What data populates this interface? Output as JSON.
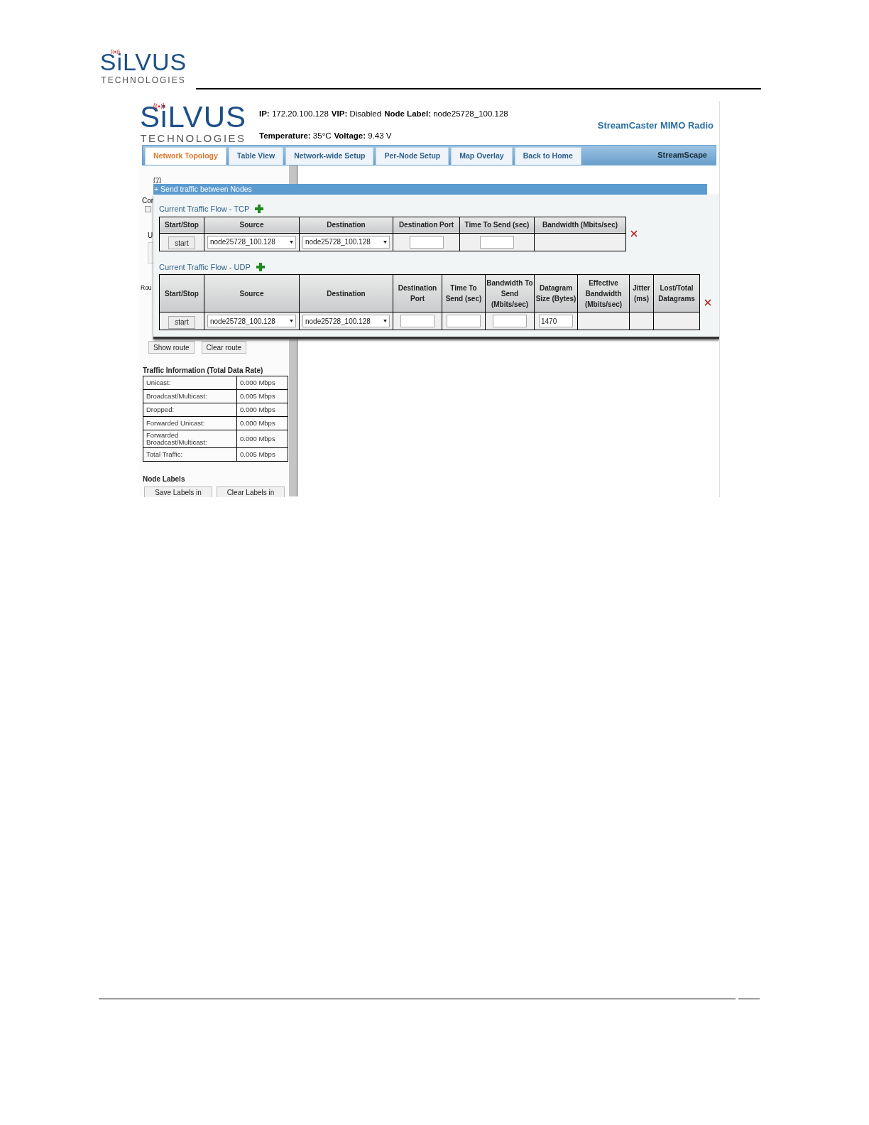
{
  "document_logo": {
    "wordmark": "SiLVUS",
    "tagline": "TECHNOLOGIES"
  },
  "app": {
    "logo": {
      "wordmark": "SiLVUS",
      "tagline": "TECHNOLOGIES"
    },
    "status_lines": [
      [
        {
          "label": "IP:",
          "value": "172.20.100.128"
        },
        {
          "label": "VIP:",
          "value": "Disabled"
        },
        {
          "label": "Node Label:",
          "value": "node25728_100.128"
        }
      ],
      [
        {
          "label": "Temperature:",
          "value": "35°C"
        },
        {
          "label": "Voltage:",
          "value": "9.43 V"
        }
      ]
    ],
    "product": "StreamCaster MIMO Radio",
    "tabs": [
      {
        "label": "Network Topology",
        "selected": true
      },
      {
        "label": "Table View",
        "selected": false
      },
      {
        "label": "Network-wide Setup",
        "selected": false
      },
      {
        "label": "Per-Node Setup",
        "selected": false
      },
      {
        "label": "Map Overlay",
        "selected": false
      },
      {
        "label": "Back to Home",
        "selected": false
      }
    ],
    "brand": "StreamScape",
    "help_link": "(?)",
    "section_bar": "+ Send traffic between Nodes",
    "covered_fragments": [
      "Cor",
      "U",
      "Rou"
    ],
    "covered_checkbox": {
      "checked": false
    },
    "flows": [
      {
        "title": "Current Traffic Flow - TCP",
        "columns": [
          "Start/Stop",
          "Source",
          "Destination",
          "Destination Port",
          "Time To Send (sec)",
          "Bandwidth (Mbits/sec)"
        ],
        "rows": [
          {
            "cells": [
              {
                "kind": "button",
                "text": "start"
              },
              {
                "kind": "select",
                "value": "node25728_100.128"
              },
              {
                "kind": "select",
                "value": "node25728_100.128"
              },
              {
                "kind": "input"
              },
              {
                "kind": "input"
              },
              {
                "kind": "empty"
              }
            ]
          }
        ]
      },
      {
        "title": "Current Traffic Flow - UDP",
        "columns": [
          "Start/Stop",
          "Source",
          "Destination",
          "Destination Port",
          "Time To Send (sec)",
          "Bandwidth To Send (Mbits/sec)",
          "Datagram Size (Bytes)",
          "Effective Bandwidth (Mbits/sec)",
          "Jitter (ms)",
          "Lost/Total Datagrams"
        ],
        "rows": [
          {
            "cells": [
              {
                "kind": "button",
                "text": "start"
              },
              {
                "kind": "select",
                "value": "node25728_100.128"
              },
              {
                "kind": "select",
                "value": "node25728_100.128"
              },
              {
                "kind": "input"
              },
              {
                "kind": "input"
              },
              {
                "kind": "input"
              },
              {
                "kind": "input",
                "value": "1470"
              },
              {
                "kind": "empty"
              },
              {
                "kind": "empty"
              },
              {
                "kind": "empty"
              }
            ]
          }
        ]
      }
    ],
    "route_buttons": [
      "Show route",
      "Clear route"
    ],
    "traffic_info": {
      "title": "Traffic Information (Total Data Rate)",
      "rows": [
        {
          "label": "Unicast:",
          "value": "0.000 Mbps"
        },
        {
          "label": "Broadcast/Multicast:",
          "value": "0.005 Mbps"
        },
        {
          "label": "Dropped:",
          "value": "0.000 Mbps"
        },
        {
          "label": "Forwarded Unicast:",
          "value": "0.000 Mbps"
        },
        {
          "label": "Forwarded Broadcast/Multicast:",
          "value": "0.000 Mbps"
        },
        {
          "label": "Total Traffic:",
          "value": "0.005 Mbps"
        }
      ]
    },
    "node_labels": {
      "title": "Node Labels",
      "buttons": [
        "Save Labels in",
        "Clear Labels in"
      ]
    }
  }
}
